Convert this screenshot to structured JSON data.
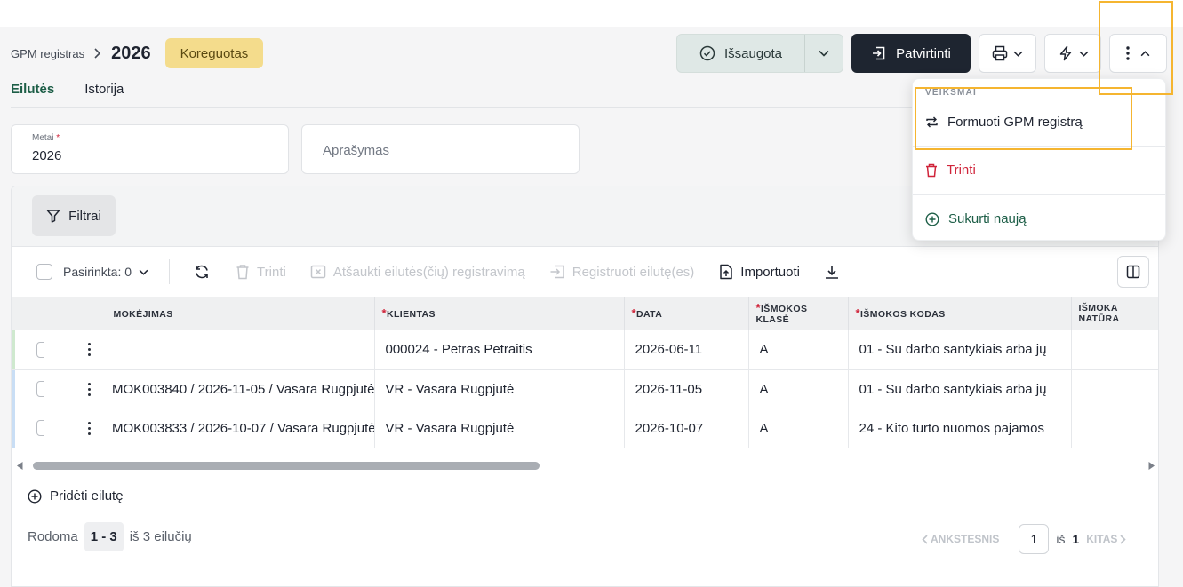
{
  "header": {
    "breadcrumb_parent": "GPM registras",
    "breadcrumb_current": "2026",
    "status_badge": "Koreguotas",
    "saved_label": "Išsaugota",
    "confirm_label": "Patvirtinti"
  },
  "tabs": [
    {
      "label": "Eilutės",
      "active": true
    },
    {
      "label": "Istorija",
      "active": false
    }
  ],
  "form": {
    "year_label": "Metai",
    "year_required_mark": "*",
    "year_value": "2026",
    "description_placeholder": "Aprašymas"
  },
  "filters_label": "Filtrai",
  "toolbar": {
    "selected_label": "Pasirinkta: 0",
    "delete_label": "Trinti",
    "cancel_registration_label": "Atšaukti eilutės(čių) registravimą",
    "register_label": "Registruoti eilutę(es)",
    "import_label": "Importuoti"
  },
  "table": {
    "required_mark": "*",
    "columns": [
      "MOKĖJIMAS",
      "KLIENTAS",
      "DATA",
      "IŠMOKOS KLASĖ",
      "IŠMOKOS KODAS",
      "IŠMOKA NATŪRA"
    ],
    "rows": [
      {
        "payment": "",
        "client": "000024 - Petras Petraitis",
        "date": "2026-06-11",
        "class": "A",
        "code": "01 - Su darbo santykiais arba jų",
        "natura": "",
        "bar_color": "#cfe9cf"
      },
      {
        "payment": "MOK003840 / 2026-11-05 / Vasara Rugpjūtė",
        "client": "VR - Vasara Rugpjūtė",
        "date": "2026-11-05",
        "class": "A",
        "code": "01 - Su darbo santykiais arba jų",
        "natura": "",
        "bar_color": "#c9def5"
      },
      {
        "payment": "MOK003833 / 2026-10-07 / Vasara Rugpjūtė",
        "client": "VR - Vasara Rugpjūtė",
        "date": "2026-10-07",
        "class": "A",
        "code": "24 - Kito turto nuomos pajamos",
        "natura": "",
        "bar_color": "#c9def5"
      }
    ]
  },
  "add_row_label": "Pridėti eilutę",
  "pagination": {
    "showing_label": "Rodoma",
    "range": "1 - 3",
    "of_rows": "iš 3 eilučių",
    "prev_label": "ANKSTESNIS",
    "page": "1",
    "of_label": "iš",
    "total_pages": "1",
    "next_label": "KITAS"
  },
  "menu": {
    "section": "VEIKSMAI",
    "items": [
      {
        "label": "Formuoti GPM registrą",
        "icon": "repeat-icon",
        "color": "#1f2430"
      },
      {
        "label": "Trinti",
        "icon": "trash-icon",
        "color": "#d0243a"
      },
      {
        "label": "Sukurti naują",
        "icon": "plus-circle-icon",
        "color": "#1d5e47"
      }
    ]
  },
  "colors": {
    "accent": "#1d5e47",
    "badge": "#f4dc8c",
    "highlight": "#f5b530",
    "danger": "#d0243a"
  }
}
